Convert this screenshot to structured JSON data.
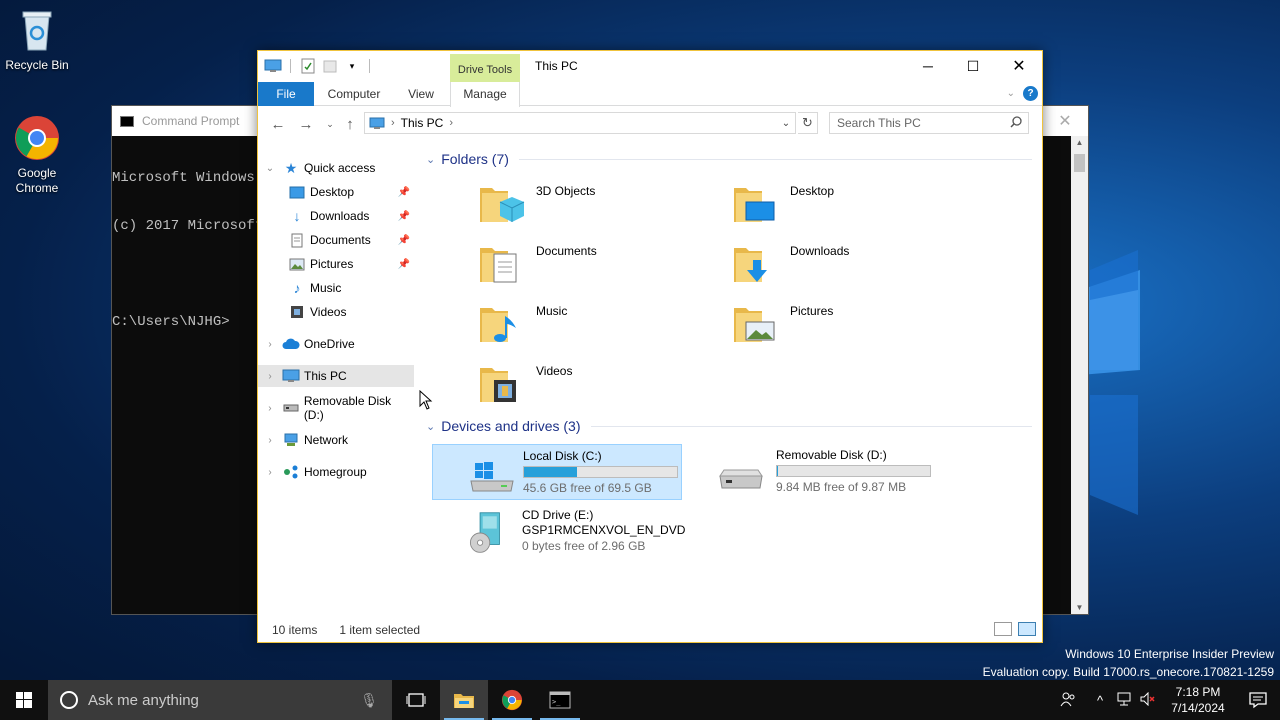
{
  "desktop": {
    "icons": [
      {
        "label": "Recycle Bin"
      },
      {
        "label": "Google Chrome"
      }
    ],
    "watermark": {
      "line1": "Windows 10 Enterprise Insider Preview",
      "line2": "Evaluation copy. Build 17000.rs_onecore.170821-1259"
    }
  },
  "cmd": {
    "title": "Command Prompt",
    "lines": [
      "Microsoft Windows",
      "(c) 2017 Microsoft",
      "",
      "C:\\Users\\NJHG>"
    ]
  },
  "explorer": {
    "context_tab": "Drive Tools",
    "title": "This PC",
    "ribbon_tabs": {
      "file": "File",
      "computer": "Computer",
      "view": "View",
      "manage": "Manage"
    },
    "address": {
      "location": "This PC"
    },
    "search_placeholder": "Search This PC",
    "nav": {
      "quick_access": "Quick access",
      "desktop": "Desktop",
      "downloads": "Downloads",
      "documents": "Documents",
      "pictures": "Pictures",
      "music": "Music",
      "videos": "Videos",
      "onedrive": "OneDrive",
      "this_pc": "This PC",
      "removable": "Removable Disk (D:)",
      "network": "Network",
      "homegroup": "Homegroup"
    },
    "folders_header": "Folders (7)",
    "folders": {
      "objects3d": "3D Objects",
      "desktop": "Desktop",
      "documents": "Documents",
      "downloads": "Downloads",
      "music": "Music",
      "pictures": "Pictures",
      "videos": "Videos"
    },
    "drives_header": "Devices and drives (3)",
    "drives": {
      "c": {
        "name": "Local Disk (C:)",
        "free": "45.6 GB free of 69.5 GB",
        "used_fraction": 0.344
      },
      "d": {
        "name": "Removable Disk (D:)",
        "free": "9.84 MB free of 9.87 MB",
        "used_fraction": 0.003
      },
      "e": {
        "name": "CD Drive (E:)",
        "label": "GSP1RMCENXVOL_EN_DVD",
        "free": "0 bytes free of 2.96 GB"
      }
    },
    "status": {
      "items": "10 items",
      "selected": "1 item selected"
    }
  },
  "taskbar": {
    "search_placeholder": "Ask me anything",
    "time": "7:18 PM",
    "date": "7/14/2024"
  },
  "colors": {
    "accent": "#1979ca",
    "drive_tools": "#d8ec9a",
    "group_header": "#1e3287"
  }
}
